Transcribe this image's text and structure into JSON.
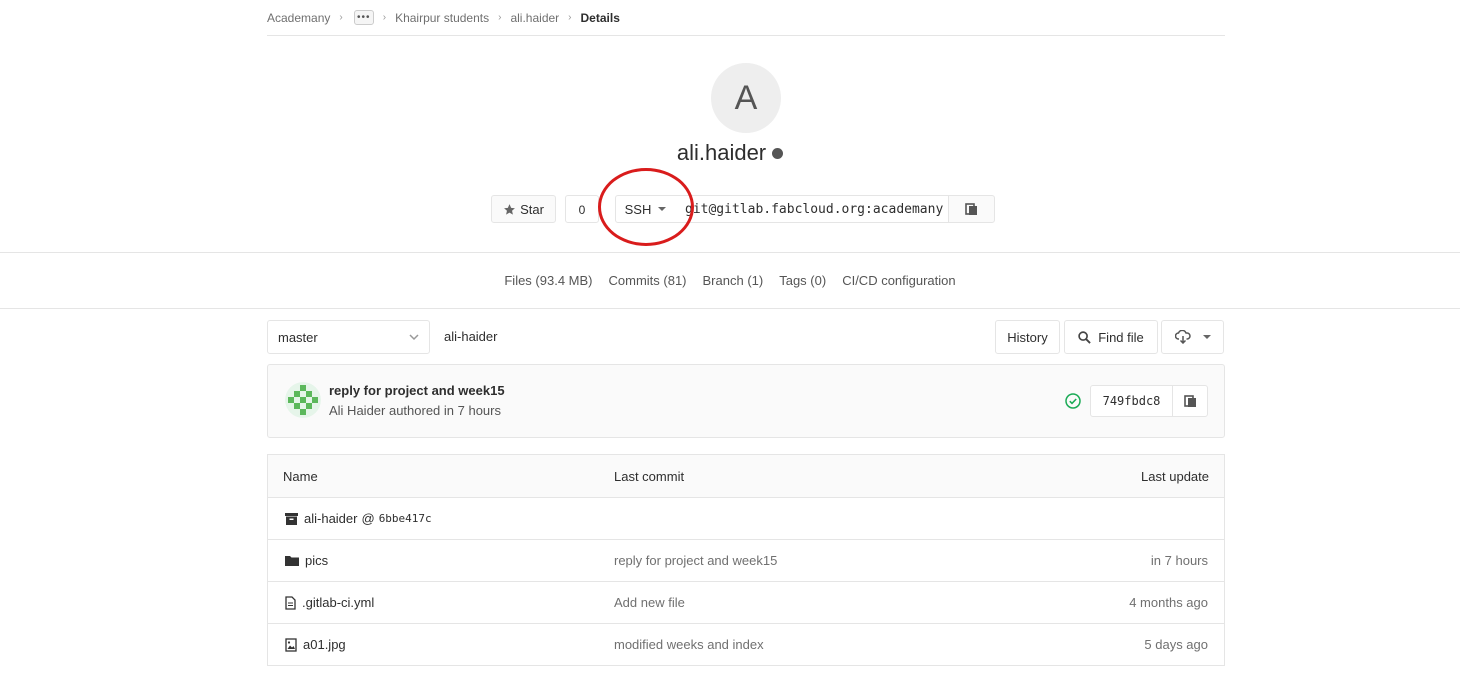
{
  "breadcrumb": {
    "items": [
      "Academany",
      "Khairpur students",
      "ali.haider"
    ],
    "more": "•••",
    "current": "Details"
  },
  "project": {
    "avatar_letter": "A",
    "name": "ali.haider"
  },
  "actions": {
    "star_label": "Star",
    "star_count": "0",
    "clone_protocol": "SSH",
    "clone_url": "git@gitlab.fabcloud.org:academany"
  },
  "nav": {
    "files": "Files (93.4 MB)",
    "commits": "Commits (81)",
    "branch": "Branch (1)",
    "tags": "Tags (0)",
    "cicd": "CI/CD configuration"
  },
  "tree": {
    "branch": "master",
    "path": "ali-haider",
    "history_label": "History",
    "find_file_label": "Find file"
  },
  "last_commit": {
    "title": "reply for project and week15",
    "meta": "Ali Haider authored in 7 hours",
    "sha": "749fbdc8"
  },
  "table": {
    "headers": {
      "name": "Name",
      "last_commit": "Last commit",
      "last_update": "Last update"
    },
    "rows": [
      {
        "name": "ali-haider",
        "submodule_prefix": "@",
        "submodule_hash": "6bbe417c",
        "commit": "",
        "updated": "",
        "icon": "archive-icon"
      },
      {
        "name": "pics",
        "commit": "reply for project and week15",
        "updated": "in 7 hours",
        "icon": "folder-icon"
      },
      {
        "name": ".gitlab-ci.yml",
        "commit": "Add new file",
        "updated": "4 months ago",
        "icon": "file-icon"
      },
      {
        "name": "a01.jpg",
        "commit": "modified weeks and index",
        "updated": "5 days ago",
        "icon": "image-file-icon"
      }
    ]
  },
  "colors": {
    "annotation": "#d91c1c",
    "pipeline_success": "#1aaa55",
    "border": "#e5e5e5"
  }
}
